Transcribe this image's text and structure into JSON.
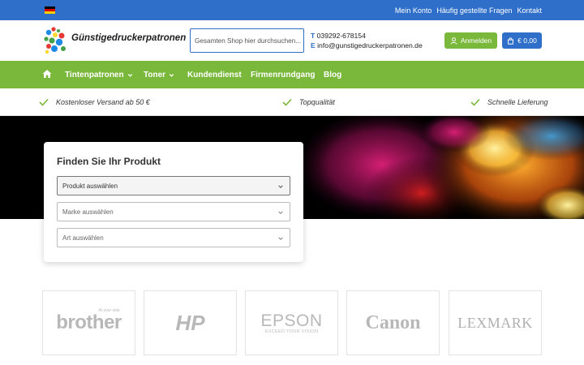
{
  "topbar": {
    "flag_colors": [
      "#000000",
      "#dd0000",
      "#ffce00"
    ],
    "links": [
      "Mein Konto",
      "Häufig gestellte Fragen",
      "Kontakt"
    ]
  },
  "header": {
    "logo_text": "Günstigedruckerpatronen",
    "search_placeholder": "Gesamten Shop hier durchsuchen...",
    "phone_prefix": "T",
    "phone": "039292-678154",
    "email_prefix": "E",
    "email": "info@gunstigedruckerpatronen.de",
    "login_label": "Anmelden",
    "cart_label": "€ 0,00"
  },
  "nav": {
    "items": [
      {
        "label": "Tintenpatronen",
        "has_dropdown": true
      },
      {
        "label": "Toner",
        "has_dropdown": true
      },
      {
        "label": "Kundendienst",
        "has_dropdown": false
      },
      {
        "label": "Firmenrundgang",
        "has_dropdown": false
      },
      {
        "label": "Blog",
        "has_dropdown": false
      }
    ]
  },
  "usp": [
    "Kostenloser Versand ab 50 €",
    "Topqualität",
    "Schnelle Lieferung"
  ],
  "finder": {
    "title": "Finden Sie Ihr Produkt",
    "selects": [
      "Produkt auswählen",
      "Marke auswählen",
      "Art auswählen"
    ]
  },
  "brands": [
    {
      "name": "brother",
      "tagline": "At your side"
    },
    {
      "name": "HP"
    },
    {
      "name": "EPSON",
      "tagline": "EXCEED YOUR VISION"
    },
    {
      "name": "Canon"
    },
    {
      "name": "LEXMARK"
    }
  ],
  "colors": {
    "blue": "#2f6fc9",
    "green": "#7ab83b"
  }
}
